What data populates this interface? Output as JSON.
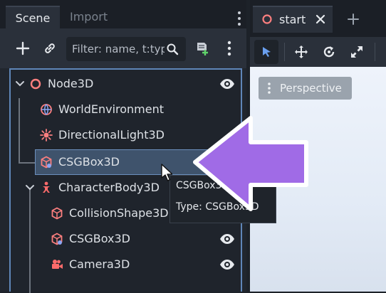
{
  "scene_dock": {
    "tabs": [
      {
        "label": "Scene",
        "active": true
      },
      {
        "label": "Import",
        "active": false
      }
    ],
    "toolbar": {
      "add_icon": "plus-icon",
      "link_icon": "link-icon",
      "filter_placeholder": "Filter: name, t:type, g:group",
      "search_icon": "search-icon",
      "script_icon": "add-script-icon",
      "menu_icon": "vertical-dots-icon"
    },
    "tree": [
      {
        "label": "Node3D",
        "icon": "node3d-circle-icon",
        "expanded": true,
        "visible_toggle": true
      },
      {
        "label": "WorldEnvironment",
        "icon": "world-environment-icon"
      },
      {
        "label": "DirectionalLight3D",
        "icon": "directional-light-icon"
      },
      {
        "label": "CSGBox3D",
        "icon": "csg-box-icon",
        "selected": true
      },
      {
        "label": "CharacterBody3D",
        "icon": "character-body-icon",
        "expanded": true
      },
      {
        "label": "CollisionShape3D",
        "icon": "collision-shape-icon"
      },
      {
        "label": "CSGBox3D",
        "icon": "csg-box-icon",
        "visible_toggle": true
      },
      {
        "label": "Camera3D",
        "icon": "camera-icon",
        "visible_toggle": true
      }
    ]
  },
  "tooltip": {
    "line1": "CSGBox3D",
    "line2": "Type: CSGBox3D"
  },
  "viewport": {
    "tab_label": "start",
    "tab_icon": "scene-ring-icon",
    "close_icon": "close-icon",
    "new_tab_icon": "plus-icon",
    "tools": [
      "select-arrow-icon",
      "move-icon",
      "rotate-icon",
      "scale-icon"
    ],
    "perspective_label": "Perspective"
  },
  "colors": {
    "accent": "#5f86b8",
    "selection": "#3f536c",
    "node3d_red": "#fc7f7f",
    "character_red": "#fc6b6b",
    "annotation_purple": "#a06be6",
    "background": "#21262e"
  }
}
